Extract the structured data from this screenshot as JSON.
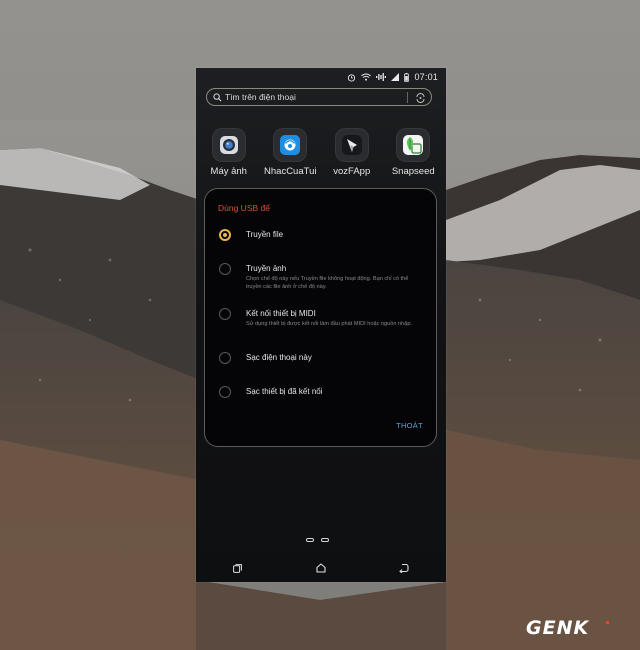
{
  "status_bar": {
    "time": "07:01",
    "icons": [
      "alarm-icon",
      "wifi-icon",
      "sound-wave-icon",
      "signal-icon",
      "battery-icon"
    ]
  },
  "search": {
    "placeholder": "Tìm trên điện thoại",
    "icon": "search-icon",
    "right_icon": "gauge-icon"
  },
  "apps": [
    {
      "label": "Máy ảnh",
      "icon": "camera-icon",
      "color": "#3b7fd4"
    },
    {
      "label": "NhacCuaTui",
      "icon": "nhaccuatui-icon",
      "color": "#1e8fe0"
    },
    {
      "label": "vozFApp",
      "icon": "vozfapp-icon",
      "color": "#e8e8e8"
    },
    {
      "label": "Snapseed",
      "icon": "snapseed-icon",
      "color": "#5ec25a"
    }
  ],
  "dialog": {
    "title": "Dùng USB để",
    "options": [
      {
        "label": "Truyền file",
        "description": "",
        "checked": true
      },
      {
        "label": "Truyền ảnh",
        "description": "Chọn chế độ này nếu Truyền file không hoạt động. Bạn chỉ có thể truyền các file ảnh ở chế độ này.",
        "checked": false
      },
      {
        "label": "Kết nối thiết bị MIDI",
        "description": "Sử dụng thiết bị được kết nối làm đầu phát MIDI hoặc nguồn nhập.",
        "checked": false
      },
      {
        "label": "Sạc điện thoại này",
        "description": "",
        "checked": false
      },
      {
        "label": "Sạc thiết bị đã kết nối",
        "description": "",
        "checked": false
      }
    ],
    "exit_label": "THOÁT",
    "title_color": "#e0503d",
    "accent_color": "#e9b44c",
    "exit_color": "#5ba4d7"
  },
  "navigation": {
    "buttons": [
      "recents-icon",
      "home-icon",
      "back-icon"
    ]
  },
  "watermark": {
    "text": "GENK"
  }
}
